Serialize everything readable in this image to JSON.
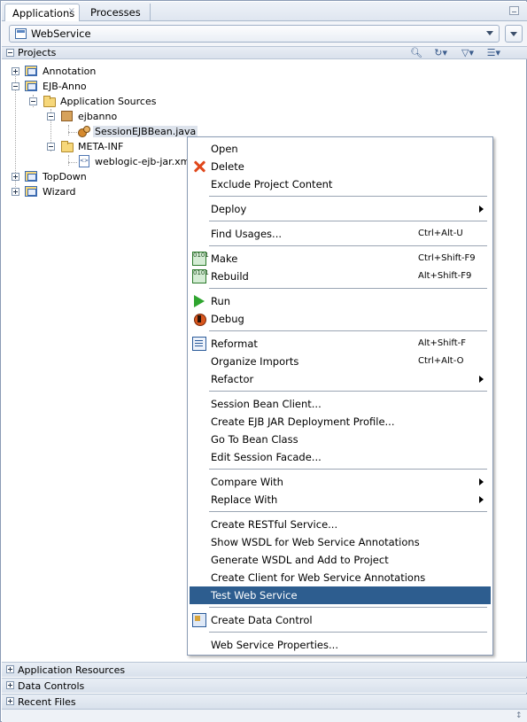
{
  "tabs": [
    {
      "label": "Applications",
      "active": true,
      "close": "×"
    },
    {
      "label": "Processes",
      "active": false
    }
  ],
  "app_selector": {
    "value": "WebService",
    "icon": "application-icon"
  },
  "projects_panel": {
    "title": "Projects",
    "expander": "−"
  },
  "tree": [
    {
      "label": "Annotation",
      "icon": "project-icon",
      "expander": "+"
    },
    {
      "label": "EJB-Anno",
      "icon": "project-icon",
      "expander": "−"
    },
    {
      "label": "Application Sources",
      "icon": "folder-icon",
      "expander": "−"
    },
    {
      "label": "ejbanno",
      "icon": "package-icon",
      "expander": "−"
    },
    {
      "label": "SessionEJBBean.java",
      "icon": "session-bean-icon",
      "selected": true
    },
    {
      "label": "META-INF",
      "icon": "folder-icon",
      "expander": "−"
    },
    {
      "label": "weblogic-ejb-jar.xml",
      "icon": "xml-file-icon"
    },
    {
      "label": "TopDown",
      "icon": "project-icon",
      "expander": "+"
    },
    {
      "label": "Wizard",
      "icon": "project-icon",
      "expander": "+"
    }
  ],
  "context_menu": {
    "items": [
      {
        "label": "Open",
        "shortcut": ""
      },
      {
        "label": "Delete",
        "shortcut": "",
        "icon": "delete-icon"
      },
      {
        "label": "Exclude Project Content",
        "shortcut": ""
      },
      {
        "label": "Deploy",
        "shortcut": "",
        "submenu": true
      },
      {
        "label": "Find Usages...",
        "shortcut": "Ctrl+Alt-U"
      },
      {
        "label": "Make",
        "shortcut": "Ctrl+Shift-F9",
        "icon": "make-icon"
      },
      {
        "label": "Rebuild",
        "shortcut": "Alt+Shift-F9",
        "icon": "rebuild-icon"
      },
      {
        "label": "Run",
        "shortcut": "",
        "icon": "run-icon"
      },
      {
        "label": "Debug",
        "shortcut": "",
        "icon": "debug-icon"
      },
      {
        "label": "Reformat",
        "shortcut": "Alt+Shift-F",
        "icon": "reformat-icon"
      },
      {
        "label": "Organize Imports",
        "shortcut": "Ctrl+Alt-O"
      },
      {
        "label": "Refactor",
        "shortcut": "",
        "submenu": true
      },
      {
        "label": "Session Bean Client...",
        "shortcut": ""
      },
      {
        "label": "Create EJB JAR Deployment Profile...",
        "shortcut": ""
      },
      {
        "label": "Go To Bean Class",
        "shortcut": ""
      },
      {
        "label": "Edit Session Facade...",
        "shortcut": ""
      },
      {
        "label": "Compare With",
        "shortcut": "",
        "submenu": true
      },
      {
        "label": "Replace With",
        "shortcut": "",
        "submenu": true
      },
      {
        "label": "Create RESTful Service...",
        "shortcut": ""
      },
      {
        "label": "Show WSDL for Web Service Annotations",
        "shortcut": ""
      },
      {
        "label": "Generate WSDL and Add to Project",
        "shortcut": ""
      },
      {
        "label": "Create Client for Web Service Annotations",
        "shortcut": ""
      },
      {
        "label": "Test Web Service",
        "shortcut": "",
        "highlighted": true
      },
      {
        "label": "Create Data Control",
        "shortcut": "",
        "icon": "data-control-icon"
      },
      {
        "label": "Web Service Properties...",
        "shortcut": ""
      }
    ]
  },
  "accordions": [
    {
      "label": "Application Resources",
      "expander": "+"
    },
    {
      "label": "Data Controls",
      "expander": "+"
    },
    {
      "label": "Recent Files",
      "expander": "+"
    }
  ],
  "colors": {
    "highlight": "#2d5d8f",
    "selection": "#dde3ec",
    "border": "#8a9bb4"
  }
}
